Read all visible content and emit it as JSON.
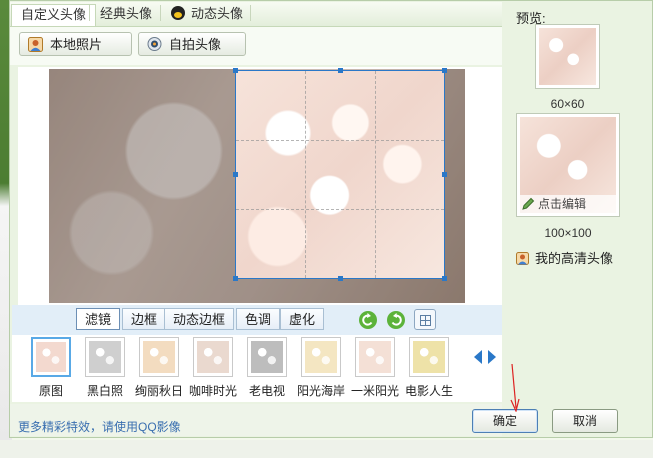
{
  "tabs": [
    {
      "label": "自定义头像",
      "active": true
    },
    {
      "label": "经典头像",
      "active": false
    },
    {
      "label": "动态头像",
      "active": false,
      "icon": "qq-penguin-icon"
    }
  ],
  "toolbar": {
    "local_photo": {
      "label": "本地照片",
      "icon": "user-photo-icon"
    },
    "selfie": {
      "label": "自拍头像",
      "icon": "webcam-icon"
    }
  },
  "filter_tabs": [
    {
      "label": "滤镜",
      "active": true
    },
    {
      "label": "边框",
      "active": false
    },
    {
      "label": "动态边框",
      "active": false
    },
    {
      "label": "色调",
      "active": false
    },
    {
      "label": "虚化",
      "active": false
    }
  ],
  "tool_icons": [
    "rotate-left-icon",
    "rotate-right-icon",
    "grid-toggle-icon"
  ],
  "filters": [
    {
      "label": "原图",
      "selected": true
    },
    {
      "label": "黑白照",
      "selected": false
    },
    {
      "label": "绚丽秋日",
      "selected": false
    },
    {
      "label": "咖啡时光",
      "selected": false
    },
    {
      "label": "老电视",
      "selected": false
    },
    {
      "label": "阳光海岸",
      "selected": false
    },
    {
      "label": "一米阳光",
      "selected": false
    },
    {
      "label": "电影人生",
      "selected": false
    }
  ],
  "footer": {
    "more_effects": "更多精彩特效，请使用QQ影像",
    "ok": "确定",
    "cancel": "取消"
  },
  "preview": {
    "title": "预览:",
    "size_small": "60×60",
    "size_large": "100×100",
    "edit_label": "点击编辑",
    "hd_avatar": "我的高清头像"
  },
  "colors": {
    "accent_blue": "#2a78c8",
    "link_blue": "#3a6fb0",
    "panel_green": "#eaf3e2"
  }
}
